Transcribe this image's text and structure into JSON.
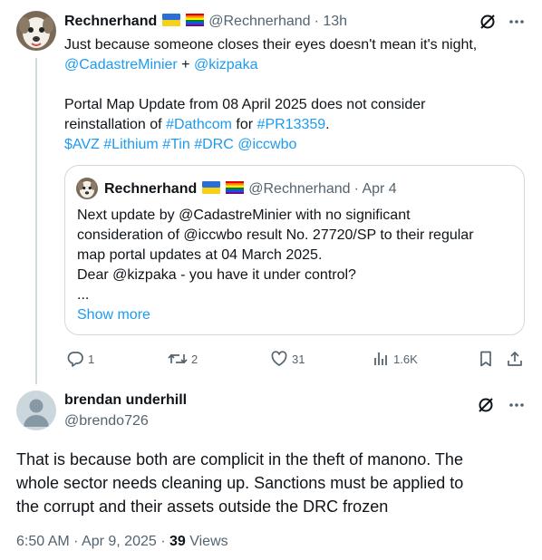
{
  "tweet": {
    "display_name": "Rechnerhand",
    "handle": "@Rechnerhand",
    "time": "· 13h",
    "line1": "Just because someone closes their eyes doesn't mean it's night,",
    "mention1": "@CadastreMinier",
    "plus": " + ",
    "mention2": "@kizpaka",
    "line3": "Portal Map Update from 08 April 2025 does not consider",
    "line4a": "reinstallation of ",
    "tag_dathcom": "#Dathcom",
    "line4b": " for ",
    "tag_pr": "#PR13359",
    "line4c": ".",
    "tags_line": [
      "$AVZ",
      "#Lithium",
      "#Tin",
      "#DRC",
      "@iccwbo"
    ]
  },
  "quote": {
    "display_name": "Rechnerhand",
    "handle": "@Rechnerhand",
    "time": "· Apr 4",
    "lines": [
      "Next update by @CadastreMinier with no significant",
      "consideration of @iccwbo result No. 27720/SP to their regular",
      "map portal updates at 04 March 2025.",
      "Dear @kizpaka - you have it under control?",
      "..."
    ],
    "show_more": "Show more"
  },
  "actions": {
    "replies": "1",
    "reposts": "2",
    "likes": "31",
    "views": "1.6K"
  },
  "reply": {
    "display_name": "brendan underhill",
    "handle": "@brendo726",
    "lines": [
      "That is because both are complicit in the theft of manono. The",
      "whole sector needs cleaning up. Sanctions must be applied to",
      "the corrupt and their assets outside the DRC frozen"
    ],
    "timestamp": "6:50 AM · Apr 9, 2025 · ",
    "views_count": "39",
    "views_label": " Views"
  },
  "colors": {
    "link": "#1d9bf0",
    "muted": "#536471",
    "border": "#cfd9de"
  }
}
